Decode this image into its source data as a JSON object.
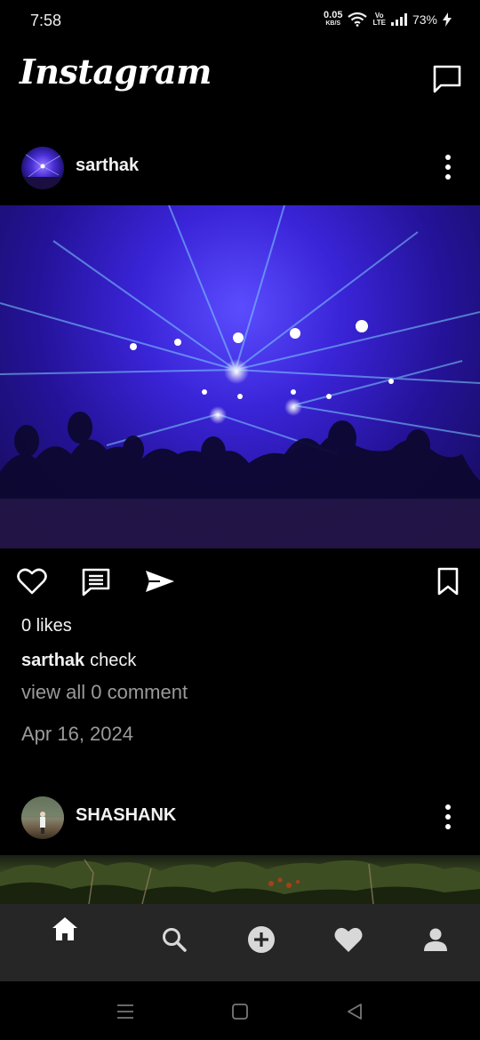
{
  "status_bar": {
    "time": "7:58",
    "net_speed": "0.05",
    "net_unit": "KB/S",
    "volte_top": "Vo",
    "volte_bottom": "LTE",
    "battery": "73%"
  },
  "header": {
    "brand": "Instagram",
    "messages_icon": "message-square-icon"
  },
  "posts": [
    {
      "username": "sarthak",
      "image_desc_icon": "concert-photo",
      "likes": "0 likes",
      "caption_user": "sarthak",
      "caption_text": "check",
      "comments_link": "view all 0 comment",
      "date": "Apr 16, 2024"
    },
    {
      "username": "SHASHANK"
    }
  ],
  "bottom_nav": {
    "items": [
      "home-icon",
      "search-icon",
      "add-icon",
      "heart-icon",
      "profile-icon"
    ]
  },
  "colors": {
    "background": "#000000",
    "nav_background": "#262626",
    "muted_text": "#9a9a9a"
  }
}
